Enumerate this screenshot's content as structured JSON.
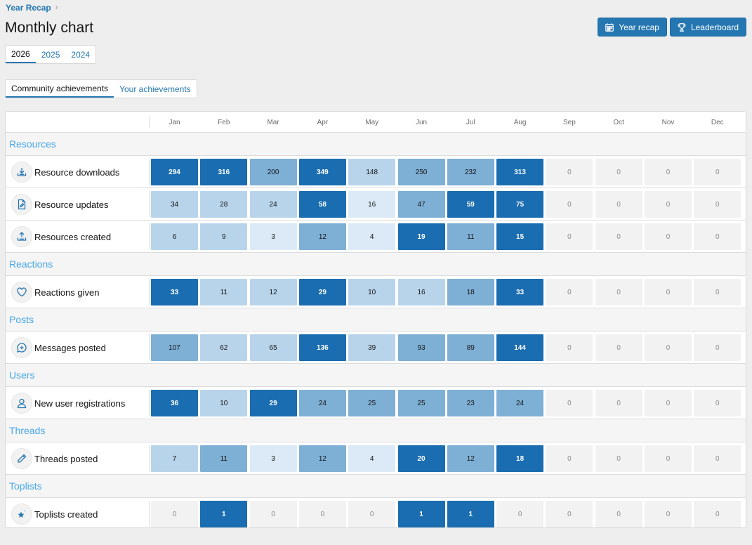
{
  "breadcrumb": {
    "label": "Year Recap"
  },
  "page_title": "Monthly chart",
  "header_buttons": {
    "year_recap": "Year recap",
    "leaderboard": "Leaderboard"
  },
  "year_tabs": [
    "2026",
    "2025",
    "2024"
  ],
  "achievement_tabs": [
    "Community achievements",
    "Your achievements"
  ],
  "months": [
    "Jan",
    "Feb",
    "Mar",
    "Apr",
    "May",
    "Jun",
    "Jul",
    "Aug",
    "Sep",
    "Oct",
    "Nov",
    "Dec"
  ],
  "colors": {
    "accent": "#2577b1",
    "section_title": "#47a7eb",
    "empty_cell": "#f2f2f2",
    "scale": [
      "#dbeaf6",
      "#b8d4ea",
      "#7eafd5",
      "#1a6db0"
    ]
  },
  "sections": [
    {
      "title": "Resources",
      "rows": [
        {
          "label": "Resource downloads",
          "icon": "download-icon",
          "values": [
            294,
            316,
            200,
            349,
            148,
            250,
            232,
            313,
            0,
            0,
            0,
            0
          ],
          "levels": [
            3,
            3,
            2,
            3,
            1,
            2,
            2,
            3,
            0,
            0,
            0,
            0
          ]
        },
        {
          "label": "Resource updates",
          "icon": "file-edit-icon",
          "values": [
            34,
            28,
            24,
            58,
            16,
            47,
            59,
            75,
            0,
            0,
            0,
            0
          ],
          "levels": [
            1,
            1,
            1,
            3,
            0.5,
            2,
            3,
            3,
            0,
            0,
            0,
            0
          ]
        },
        {
          "label": "Resources created",
          "icon": "upload-icon",
          "values": [
            6,
            9,
            3,
            12,
            4,
            19,
            11,
            15,
            0,
            0,
            0,
            0
          ],
          "levels": [
            1,
            1,
            0.5,
            2,
            0.5,
            3,
            2,
            3,
            0,
            0,
            0,
            0
          ]
        }
      ]
    },
    {
      "title": "Reactions",
      "rows": [
        {
          "label": "Reactions given",
          "icon": "heart-icon",
          "values": [
            33,
            11,
            12,
            29,
            10,
            16,
            18,
            33,
            0,
            0,
            0,
            0
          ],
          "levels": [
            3,
            1,
            1,
            3,
            1,
            1,
            2,
            3,
            0,
            0,
            0,
            0
          ]
        }
      ]
    },
    {
      "title": "Posts",
      "rows": [
        {
          "label": "Messages posted",
          "icon": "message-plus-icon",
          "values": [
            107,
            62,
            65,
            136,
            39,
            93,
            89,
            144,
            0,
            0,
            0,
            0
          ],
          "levels": [
            2,
            1,
            1,
            3,
            1,
            2,
            2,
            3,
            0,
            0,
            0,
            0
          ]
        }
      ]
    },
    {
      "title": "Users",
      "rows": [
        {
          "label": "New user registrations",
          "icon": "user-icon",
          "values": [
            36,
            10,
            29,
            24,
            25,
            25,
            23,
            24,
            0,
            0,
            0,
            0
          ],
          "levels": [
            3,
            1,
            3,
            2,
            2,
            2,
            2,
            2,
            0,
            0,
            0,
            0
          ]
        }
      ]
    },
    {
      "title": "Threads",
      "rows": [
        {
          "label": "Threads posted",
          "icon": "pencil-icon",
          "values": [
            7,
            11,
            3,
            12,
            4,
            20,
            12,
            18,
            0,
            0,
            0,
            0
          ],
          "levels": [
            1,
            2,
            0.5,
            2,
            0.5,
            3,
            2,
            3,
            0,
            0,
            0,
            0
          ]
        }
      ]
    },
    {
      "title": "Toplists",
      "rows": [
        {
          "label": "Toplists created",
          "icon": "star-sparkle-icon",
          "values": [
            0,
            1,
            0,
            0,
            0,
            1,
            1,
            0,
            0,
            0,
            0,
            0
          ],
          "levels": [
            0,
            3,
            0,
            0,
            0,
            3,
            3,
            0,
            0,
            0,
            0,
            0
          ]
        }
      ]
    }
  ]
}
